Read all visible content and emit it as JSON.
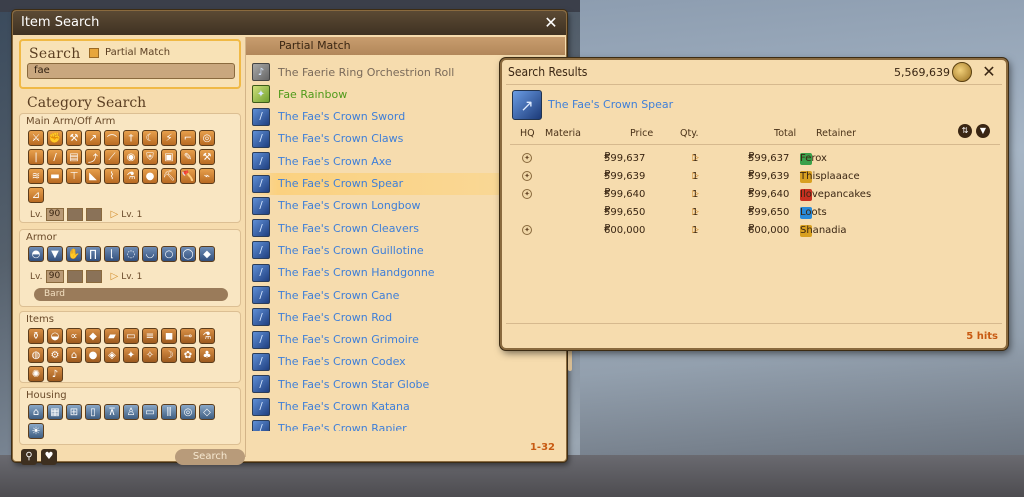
{
  "window_title": "Item Search",
  "search": {
    "title": "Search",
    "partial_match_label": "Partial Match",
    "query": "fae"
  },
  "category": {
    "title": "Category Search",
    "groups": {
      "main_arm": {
        "label": "Main Arm/Off Arm",
        "lv_label": "Lv.",
        "lv_value": "90",
        "lv_target": "Lv. 1"
      },
      "armor": {
        "label": "Armor",
        "lv_label": "Lv.",
        "lv_value": "90",
        "lv_target": "Lv. 1",
        "class_select": "Bard"
      },
      "items": {
        "label": "Items"
      },
      "housing": {
        "label": "Housing"
      }
    },
    "search_button": "Search"
  },
  "results_panel": {
    "header": "Partial Match",
    "page_count": "1-32",
    "items": [
      {
        "name": "The Faerie Ring Orchestrion Roll",
        "style": "gray",
        "icon": "scroll-icon"
      },
      {
        "name": "Fae Rainbow",
        "style": "green",
        "icon": "rainbow-icon"
      },
      {
        "name": "The Fae's Crown Sword",
        "style": "blue",
        "icon": "sword-icon"
      },
      {
        "name": "The Fae's Crown Claws",
        "style": "blue",
        "icon": "claws-icon"
      },
      {
        "name": "The Fae's Crown Axe",
        "style": "blue",
        "icon": "axe-icon"
      },
      {
        "name": "The Fae's Crown Spear",
        "style": "blue",
        "icon": "spear-icon",
        "selected": true
      },
      {
        "name": "The Fae's Crown Longbow",
        "style": "blue",
        "icon": "bow-icon"
      },
      {
        "name": "The Fae's Crown Cleavers",
        "style": "blue",
        "icon": "cleavers-icon"
      },
      {
        "name": "The Fae's Crown Guillotine",
        "style": "blue",
        "icon": "scythe-icon"
      },
      {
        "name": "The Fae's Crown Handgonne",
        "style": "blue",
        "icon": "gun-icon"
      },
      {
        "name": "The Fae's Crown Cane",
        "style": "blue",
        "icon": "cane-icon"
      },
      {
        "name": "The Fae's Crown Rod",
        "style": "blue",
        "icon": "rod-icon"
      },
      {
        "name": "The Fae's Crown Grimoire",
        "style": "blue",
        "icon": "book-icon"
      },
      {
        "name": "The Fae's Crown Codex",
        "style": "blue",
        "icon": "codex-icon"
      },
      {
        "name": "The Fae's Crown Star Globe",
        "style": "blue",
        "icon": "globe-icon"
      },
      {
        "name": "The Fae's Crown Katana",
        "style": "blue",
        "icon": "katana-icon"
      },
      {
        "name": "The Fae's Crown Rapier",
        "style": "blue",
        "icon": "rapier-icon"
      }
    ]
  },
  "search_results": {
    "title": "Search Results",
    "gil": "5,569,639",
    "item_name": "The Fae's Crown Spear",
    "columns": {
      "hq": "HQ",
      "materia": "Materia",
      "price": "Price",
      "qty": "Qty.",
      "total": "Total",
      "retainer": "Retainer"
    },
    "rows": [
      {
        "hq": true,
        "price": "599,637",
        "qty": "1",
        "total": "599,637",
        "retainer": "Ferox",
        "ret_color": "#3aa04a"
      },
      {
        "hq": true,
        "price": "599,639",
        "qty": "1",
        "total": "599,639",
        "retainer": "Thisplaaace",
        "ret_color": "#d8a020"
      },
      {
        "hq": true,
        "price": "599,640",
        "qty": "1",
        "total": "599,640",
        "retainer": "Ilovepancakes",
        "ret_color": "#c83020"
      },
      {
        "hq": false,
        "price": "599,650",
        "qty": "1",
        "total": "599,650",
        "retainer": "Loots",
        "ret_color": "#2a8ad8"
      },
      {
        "hq": true,
        "price": "600,000",
        "qty": "1",
        "total": "600,000",
        "retainer": "Shanadia",
        "ret_color": "#d8a020"
      }
    ],
    "currency_symbol": "₽",
    "hits": "5 hits"
  },
  "colors": {
    "accent": "#f0b945",
    "window_bg": "#f6dcae",
    "link_blue": "#3f7fd8",
    "hits_orange": "#c85a12"
  }
}
